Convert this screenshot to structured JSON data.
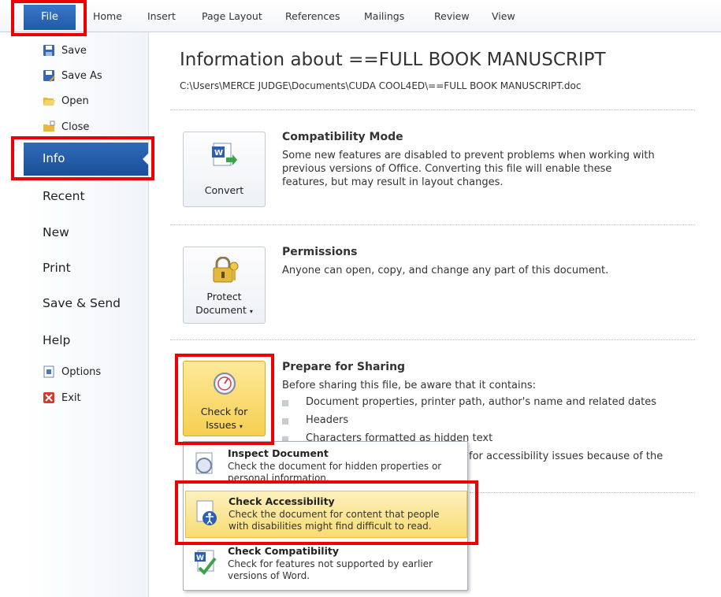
{
  "ribbon": {
    "file_tab": "File",
    "tabs": [
      "Home",
      "Insert",
      "Page Layout",
      "References",
      "Mailings",
      "Review",
      "View"
    ]
  },
  "nav": {
    "save": "Save",
    "save_as": "Save As",
    "open": "Open",
    "close": "Close",
    "info": "Info",
    "recent": "Recent",
    "new": "New",
    "print": "Print",
    "save_send": "Save & Send",
    "help": "Help",
    "options": "Options",
    "exit": "Exit"
  },
  "info": {
    "title": "Information about ==FULL BOOK MANUSCRIPT",
    "path": "C:\\Users\\MERCE JUDGE\\Documents\\CUDA COOL4ED\\==FULL BOOK MANUSCRIPT.doc"
  },
  "compat": {
    "button": "Convert",
    "heading": "Compatibility Mode",
    "text": "Some new features are disabled to prevent problems when working with previous versions of Office. Converting this file will enable these features, but may result in layout changes."
  },
  "permissions": {
    "button_line1": "Protect",
    "button_line2": "Document",
    "heading": "Permissions",
    "text": "Anyone can open, copy, and change any part of this document."
  },
  "prepare": {
    "button_line1": "Check for",
    "button_line2": "Issues",
    "heading": "Prepare for Sharing",
    "text": "Before sharing this file, be aware that it contains:",
    "bullets": [
      "Document properties, printer path, author's name and related dates",
      "Headers",
      "Characters formatted as hidden text"
    ],
    "partial_text": "for accessibility issues because of the"
  },
  "menu": {
    "items": [
      {
        "title": "Inspect Document",
        "desc": "Check the document for hidden properties or personal information."
      },
      {
        "title": "Check Accessibility",
        "desc": "Check the document for content that people with disabilities might find difficult to read."
      },
      {
        "title": "Check Compatibility",
        "desc": "Check for features not supported by earlier versions of Word."
      }
    ]
  },
  "colors": {
    "accent": "#2a62b0",
    "highlight": "#f9dc72",
    "callout": "#ee0000"
  }
}
